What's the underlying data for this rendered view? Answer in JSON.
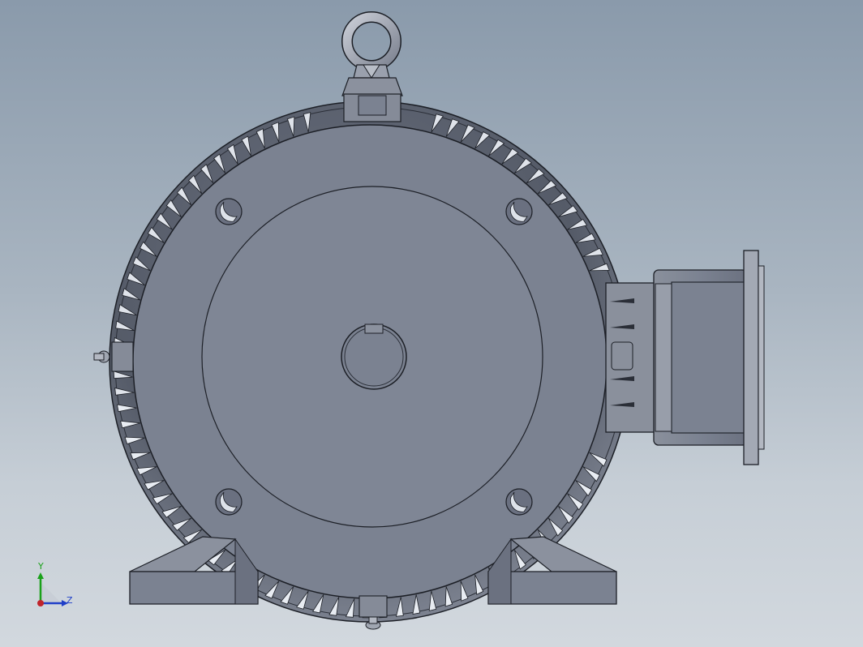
{
  "viewport": {
    "view": "front",
    "background_top": "#8a9aab",
    "background_bottom": "#d2d8de"
  },
  "model": {
    "name": "electric-motor",
    "parts": [
      "eye-bolt",
      "motor-housing",
      "cooling-fins",
      "end-shield",
      "shaft-bore",
      "shaft-key",
      "mounting-bolt-holes",
      "mounting-feet",
      "terminal-box",
      "grease-nipple",
      "drain-plug"
    ],
    "colors": {
      "body": "#7b8291",
      "body_dark": "#5f6674",
      "edge": "#1c1f26",
      "fin_dark": "#4a505d",
      "fin_light": "#e8ecf2"
    }
  },
  "triad": {
    "y_label": "Y",
    "z_label": "Z",
    "y_color": "#1aa11a",
    "z_color": "#1f3fc8",
    "x_color": "#c0242b"
  }
}
